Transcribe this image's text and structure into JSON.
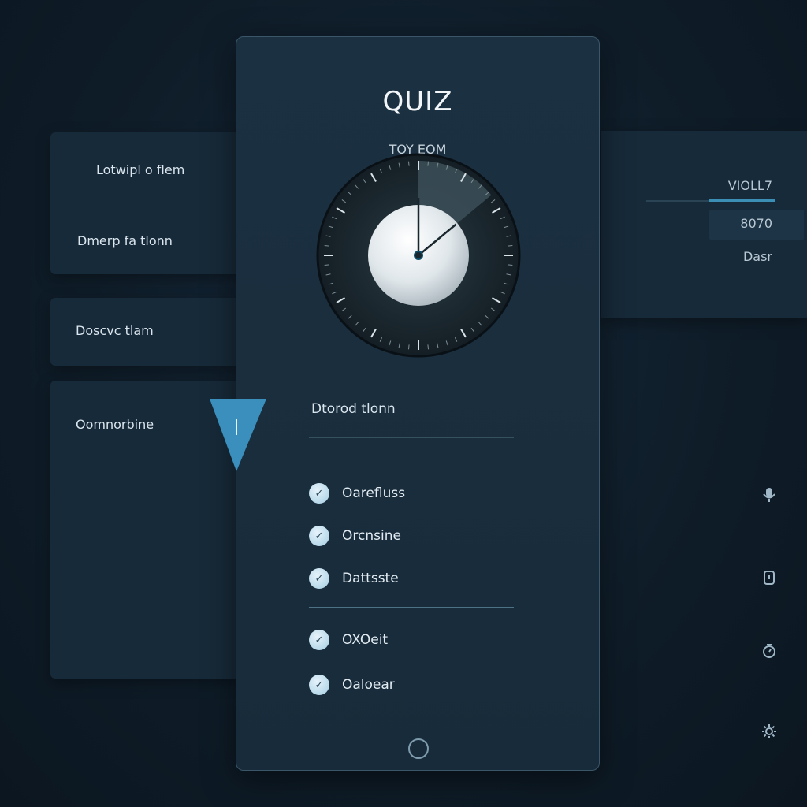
{
  "quiz": {
    "title": "QUIZ",
    "subtitle": "TOY EOM",
    "section_label": "Dtorod tlonn",
    "options": [
      {
        "label": "Oarefluss",
        "glyph": "✓"
      },
      {
        "label": "Orcnsine",
        "glyph": "✓"
      },
      {
        "label": "Dattsste",
        "glyph": "✓"
      },
      {
        "label": "OXOeit",
        "glyph": "✓"
      },
      {
        "label": "Oaloear",
        "glyph": "✓"
      }
    ],
    "dial_progress": 0.14
  },
  "left_panel": {
    "card_a": {
      "line1": "Lotwipl o flem",
      "line2": "Dmerp fa tlonn"
    },
    "card_b": {
      "text": "Doscvc tlam"
    },
    "card_c": {
      "text": "Oomnorbine"
    }
  },
  "right_panel": {
    "label": "VIOLL7",
    "value": "8070",
    "caption": "Dasr"
  },
  "side_icons": [
    "microphone-icon",
    "lock-icon",
    "timer-icon",
    "settings-icon"
  ],
  "colors": {
    "accent": "#3b8fb4",
    "background": "#0e1b26",
    "card": "#172a39",
    "radio": "#b8d9ea"
  }
}
